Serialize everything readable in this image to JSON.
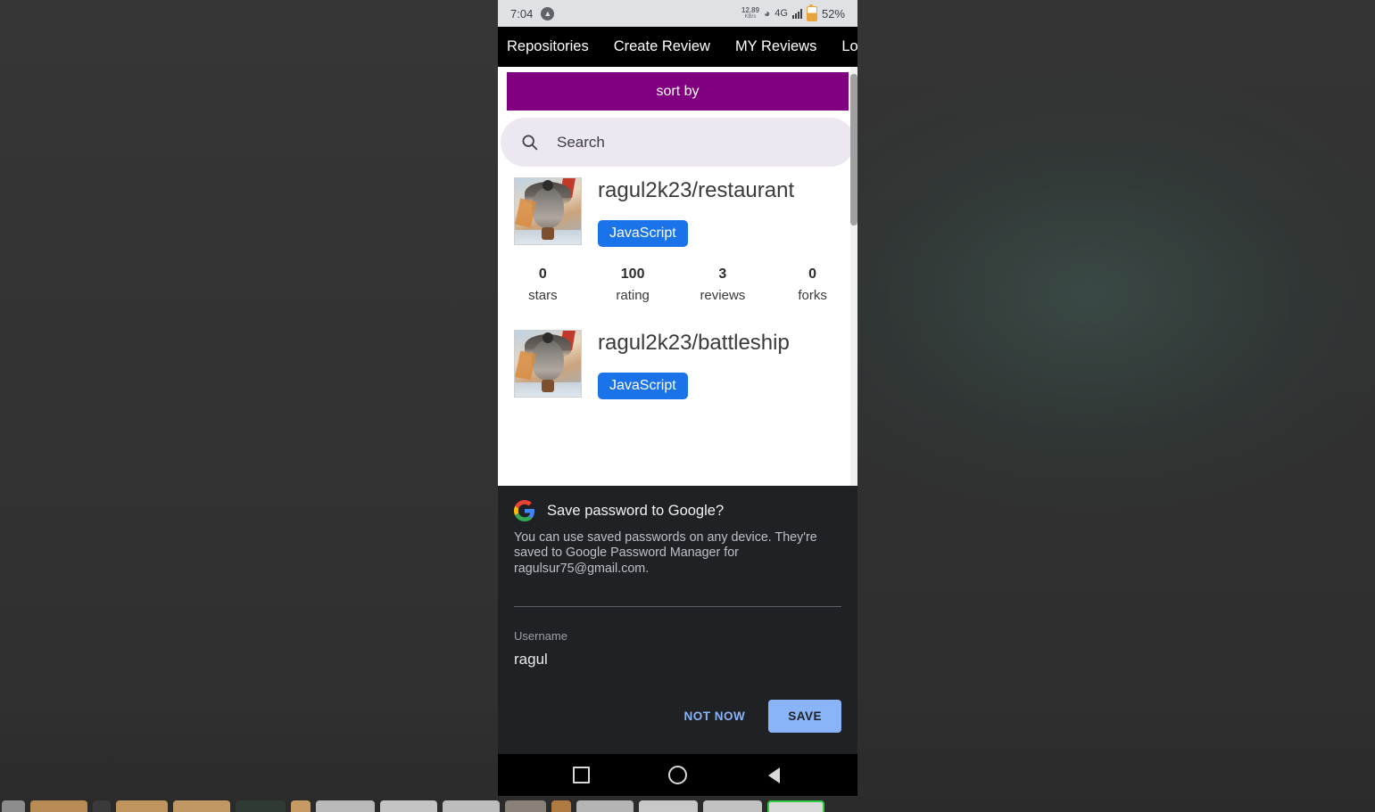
{
  "status_bar": {
    "time": "7:04",
    "left_icon": "shield-app-icon",
    "net_speed_value": "12.89",
    "net_speed_unit": "KB/s",
    "network_type": "4G",
    "battery_percent": "52%"
  },
  "app_nav": {
    "items": [
      {
        "label": "Repositories",
        "name": "nav-repositories"
      },
      {
        "label": "Create Review",
        "name": "nav-create-review"
      },
      {
        "label": "MY Reviews",
        "name": "nav-my-reviews"
      },
      {
        "label": "Log O",
        "name": "nav-log-out"
      }
    ]
  },
  "toolbar": {
    "sort_by_label": "sort by",
    "sort_by_color": "#800080"
  },
  "search": {
    "placeholder": "Search",
    "value": "",
    "icon": "search-icon"
  },
  "repositories": [
    {
      "title": "ragul2k23/restaurant",
      "language": "JavaScript",
      "language_color": "#1a73e8",
      "stats": [
        {
          "value": "0",
          "label": "stars"
        },
        {
          "value": "100",
          "label": "rating"
        },
        {
          "value": "3",
          "label": "reviews"
        },
        {
          "value": "0",
          "label": "forks"
        }
      ]
    },
    {
      "title": "ragul2k23/battleship",
      "language": "JavaScript",
      "language_color": "#1a73e8",
      "stats": []
    }
  ],
  "password_dialog": {
    "brand_icon": "google-g-icon",
    "title": "Save password to Google?",
    "description": "You can use saved passwords on any device. They're saved to Google Password Manager for ragulsur75@gmail.com.",
    "field_label": "Username",
    "field_value": "ragul",
    "not_now_label": "NOT NOW",
    "save_label": "SAVE",
    "accent_color": "#8ab4f8"
  },
  "android_nav": {
    "recents": "recents-square-icon",
    "home": "home-circle-icon",
    "back": "back-triangle-icon"
  }
}
